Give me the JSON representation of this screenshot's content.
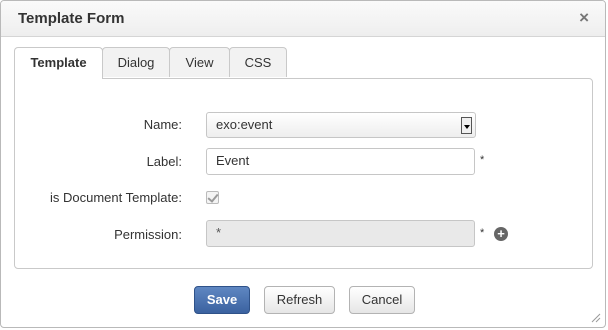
{
  "dialog": {
    "title": "Template Form",
    "close_glyph": "×"
  },
  "tabs": [
    {
      "label": "Template",
      "active": true
    },
    {
      "label": "Dialog",
      "active": false
    },
    {
      "label": "View",
      "active": false
    },
    {
      "label": "CSS",
      "active": false
    }
  ],
  "form": {
    "name_label": "Name:",
    "name_value": "exo:event",
    "label_label": "Label:",
    "label_value": "Event",
    "label_required": "*",
    "doc_template_label": "is Document Template:",
    "doc_template_checked": true,
    "permission_label": "Permission:",
    "permission_value": "*",
    "permission_required": "*",
    "add_permission_icon": "plus-circle-icon"
  },
  "buttons": {
    "save": "Save",
    "refresh": "Refresh",
    "cancel": "Cancel"
  },
  "colors": {
    "primary_button": "#4a72b0",
    "titlebar": "#f2f2f2",
    "disabled_field": "#e9e9e9"
  }
}
